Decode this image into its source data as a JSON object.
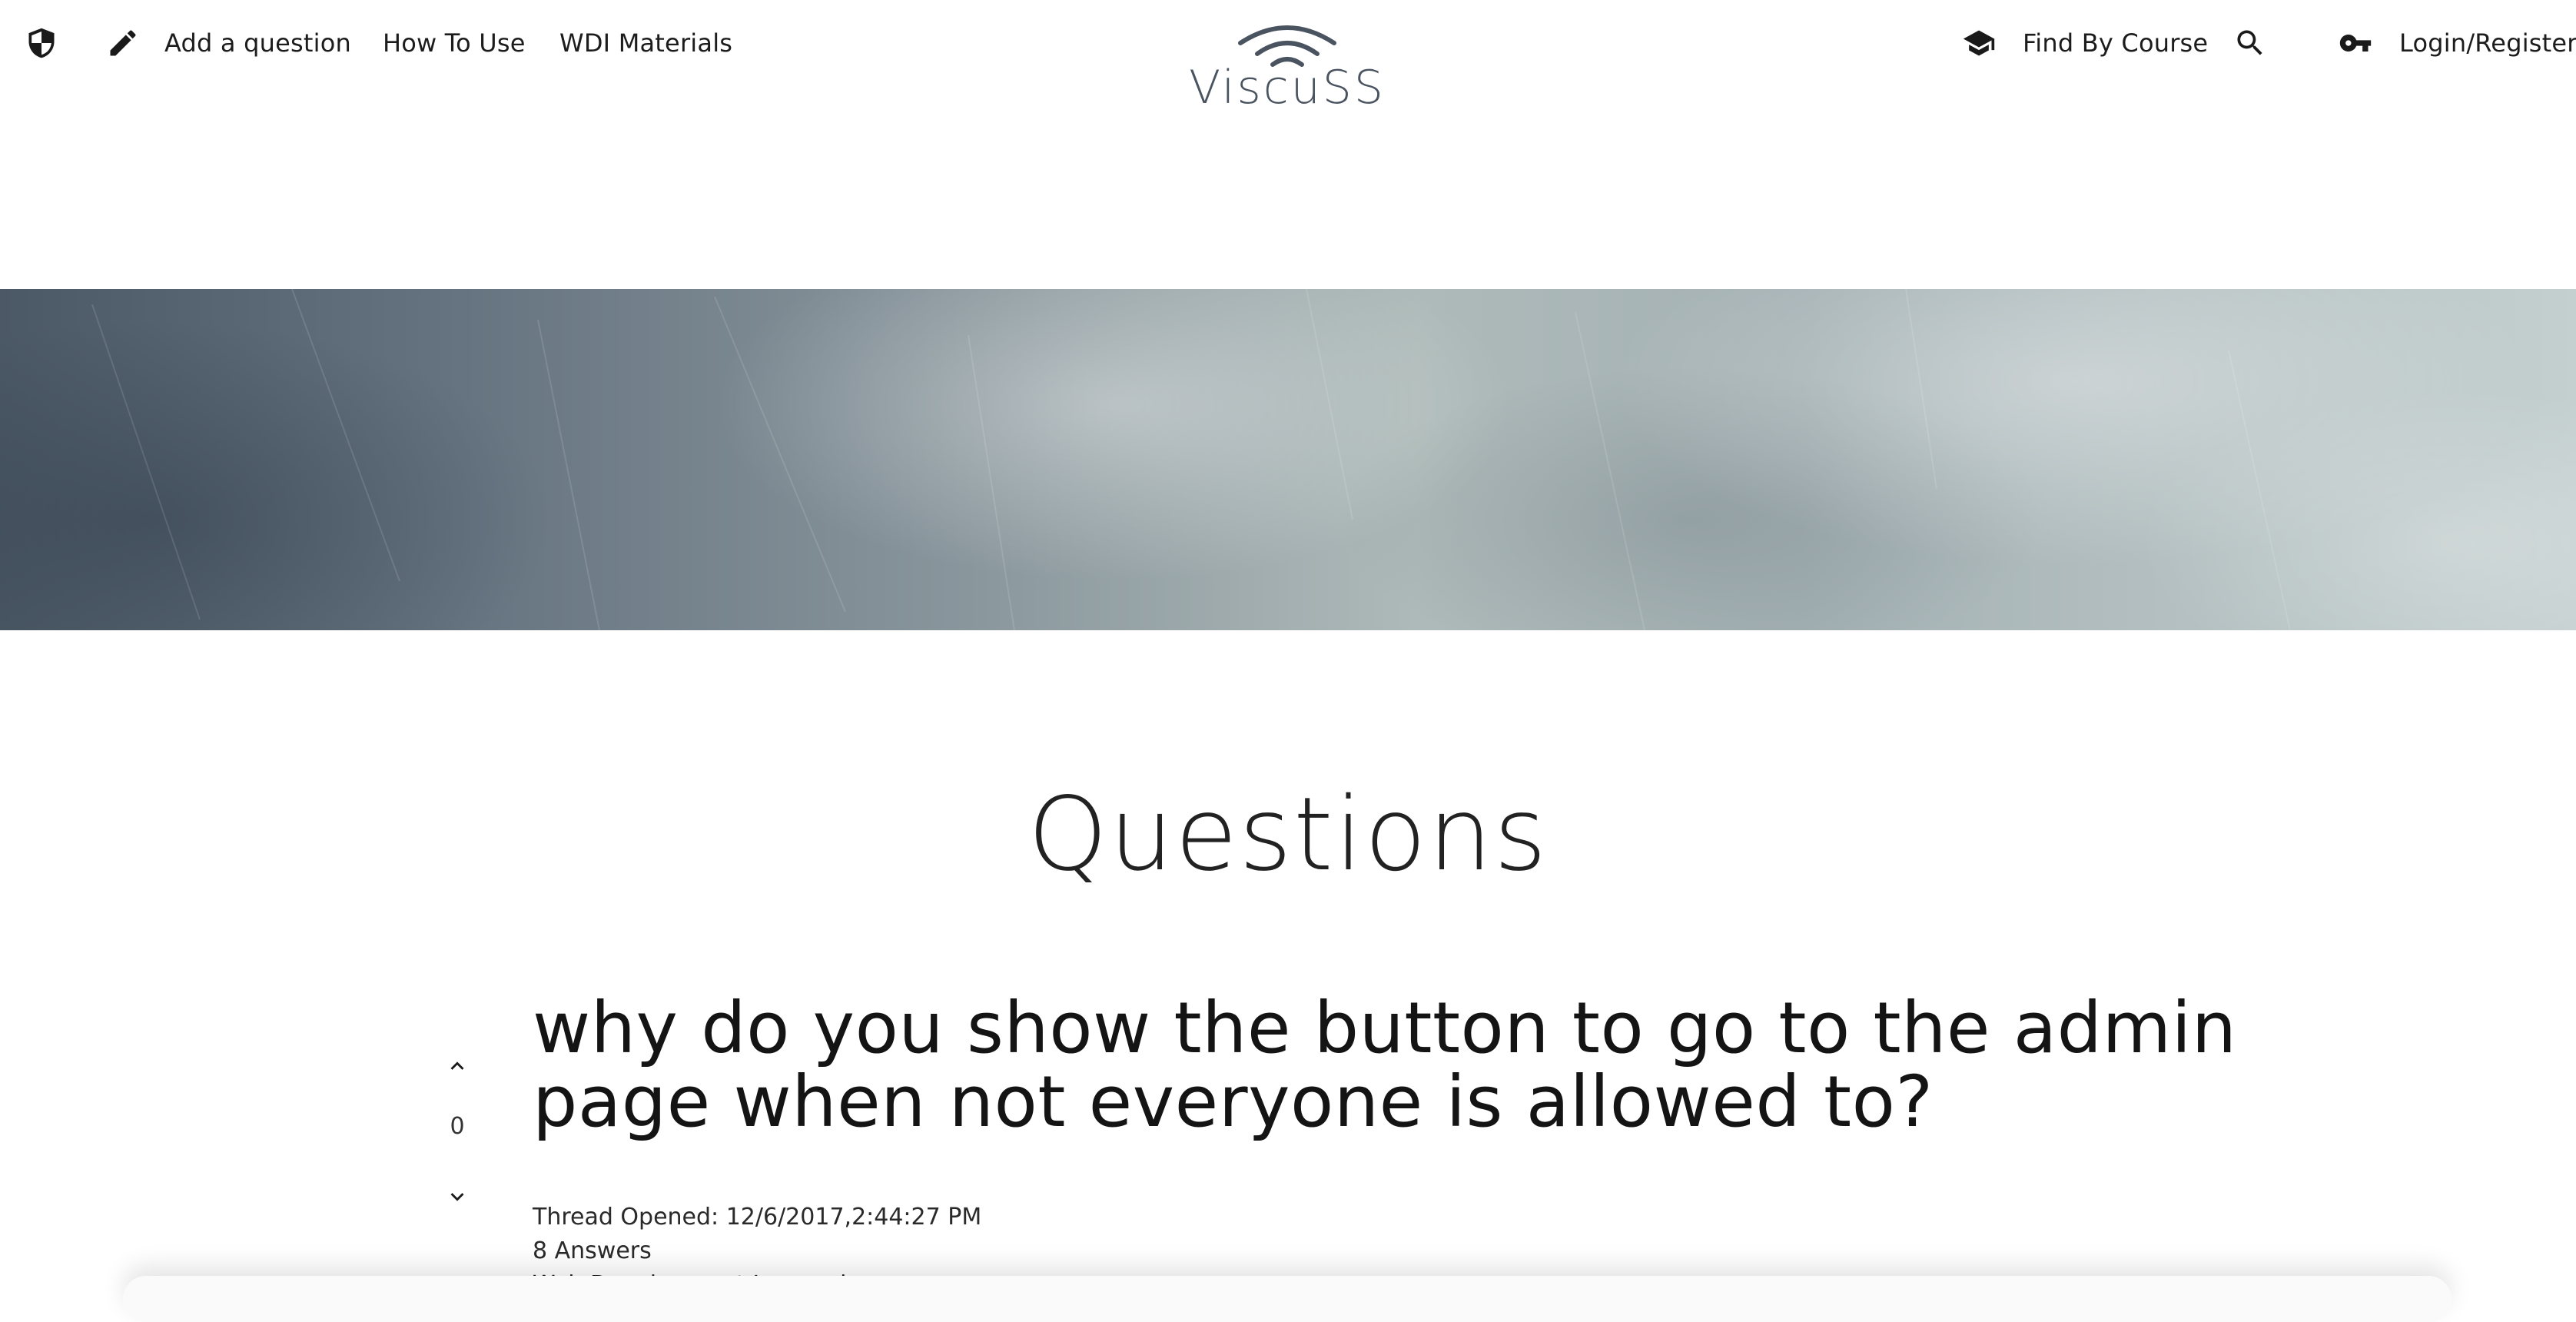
{
  "nav": {
    "left_items": [
      {
        "label": "Add a question",
        "icon": "pencil-icon"
      },
      {
        "label": "How To Use"
      },
      {
        "label": "WDI Materials"
      }
    ],
    "admin_icon": "shield-icon",
    "right_items": [
      {
        "label": "Find By Course",
        "icon": "graduation-cap-icon"
      },
      {
        "label": "Login/Register",
        "icon": "key-icon"
      }
    ],
    "search_icon": "search-icon"
  },
  "logo": {
    "text": "ViscuSS",
    "icon": "wifi-signal-icon",
    "color": "#4a5360"
  },
  "page": {
    "title": "Questions"
  },
  "question": {
    "votes": "0",
    "title": "why do you show the button to go to the admin page when not everyone is allowed to?",
    "opened": "Thread Opened: 12/6/2017,2:44:27 PM",
    "answers": "8 Answers",
    "course": "Web Development Immersive"
  },
  "colors": {
    "text": "#1f1f1f",
    "hero_dark": "#4b5866",
    "hero_light": "#c4cfcf"
  }
}
